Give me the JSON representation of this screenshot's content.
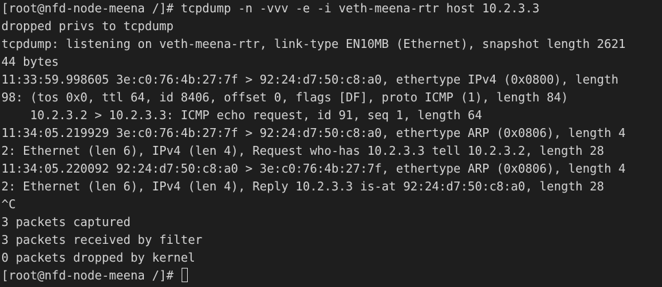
{
  "terminal": {
    "lines": [
      "[root@nfd-node-meena /]# tcpdump -n -vvv -e -i veth-meena-rtr host 10.2.3.3",
      "dropped privs to tcpdump",
      "tcpdump: listening on veth-meena-rtr, link-type EN10MB (Ethernet), snapshot length 2621",
      "44 bytes",
      "11:33:59.998605 3e:c0:76:4b:27:7f > 92:24:d7:50:c8:a0, ethertype IPv4 (0x0800), length",
      "98: (tos 0x0, ttl 64, id 8406, offset 0, flags [DF], proto ICMP (1), length 84)",
      "    10.2.3.2 > 10.2.3.3: ICMP echo request, id 91, seq 1, length 64",
      "11:34:05.219929 3e:c0:76:4b:27:7f > 92:24:d7:50:c8:a0, ethertype ARP (0x0806), length 4",
      "2: Ethernet (len 6), IPv4 (len 4), Request who-has 10.2.3.3 tell 10.2.3.2, length 28",
      "11:34:05.220092 92:24:d7:50:c8:a0 > 3e:c0:76:4b:27:7f, ethertype ARP (0x0806), length 4",
      "2: Ethernet (len 6), IPv4 (len 4), Reply 10.2.3.3 is-at 92:24:d7:50:c8:a0, length 28",
      "^C",
      "3 packets captured",
      "3 packets received by filter",
      "0 packets dropped by kernel"
    ],
    "prompt": "[root@nfd-node-meena /]# ",
    "colors": {
      "background": "#1e1e1e",
      "foreground": "#d4d4d4"
    }
  }
}
